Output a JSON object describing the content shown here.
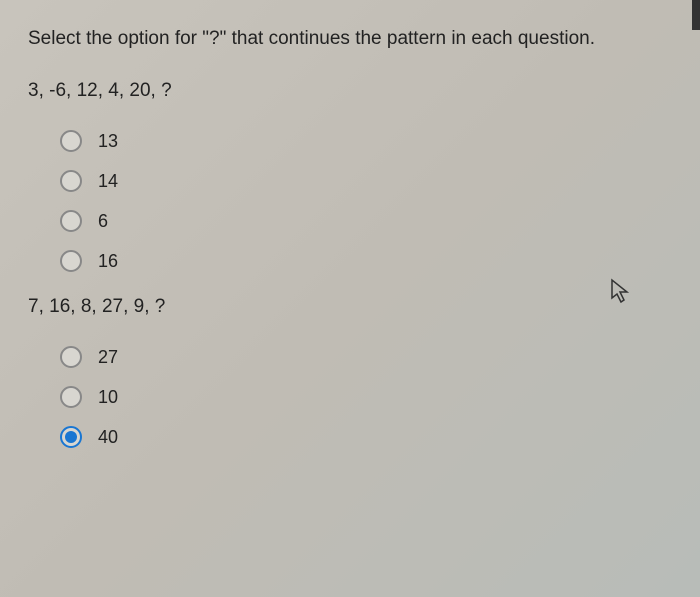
{
  "instruction": "Select the option for \"?\" that continues the pattern in each question.",
  "questions": [
    {
      "sequence": "3, -6, 12, 4, 20, ?",
      "options": [
        {
          "label": "13",
          "selected": false
        },
        {
          "label": "14",
          "selected": false
        },
        {
          "label": "6",
          "selected": false
        },
        {
          "label": "16",
          "selected": false
        }
      ]
    },
    {
      "sequence": "7, 16, 8, 27, 9, ?",
      "options": [
        {
          "label": "27",
          "selected": false
        },
        {
          "label": "10",
          "selected": false
        },
        {
          "label": "40",
          "selected": true
        }
      ]
    }
  ]
}
